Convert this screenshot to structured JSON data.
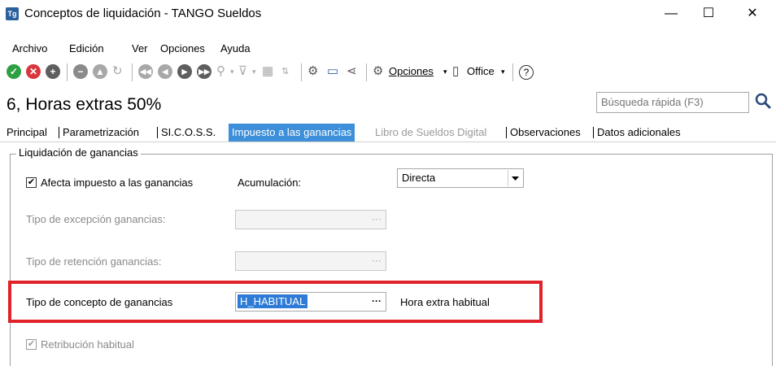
{
  "window": {
    "app_icon_text": "Tg",
    "title": "Conceptos de liquidación - TANGO Sueldos",
    "minimize": "—",
    "maximize": "☐",
    "close": "✕"
  },
  "menu": {
    "items": [
      "Archivo",
      "Edición",
      "Ver",
      "Opciones",
      "Ayuda"
    ]
  },
  "toolbar": {
    "opciones_label": "Opciones",
    "office_label": "Office",
    "help": "?"
  },
  "record": {
    "title": "6, Horas extras  50%"
  },
  "search": {
    "placeholder": "Búsqueda rápida (F3)"
  },
  "tabs": [
    {
      "label": "Principal",
      "state": "normal"
    },
    {
      "label": "Parametrización",
      "state": "normal"
    },
    {
      "label": "SI.C.O.S.S.",
      "state": "normal"
    },
    {
      "label": "Impuesto a las ganancias",
      "state": "active"
    },
    {
      "label": "Libro de Sueldos Digital",
      "state": "disabled"
    },
    {
      "label": "Observaciones",
      "state": "normal"
    },
    {
      "label": "Datos adicionales",
      "state": "normal"
    }
  ],
  "group": {
    "title": "Liquidación de ganancias",
    "afecta_checkbox": {
      "label": "Afecta impuesto a las ganancias",
      "checked": true
    },
    "acumulacion": {
      "label": "Acumulación:",
      "value": "Directa"
    },
    "tipo_excepcion": {
      "label": "Tipo de excepción ganancias:",
      "value": ""
    },
    "tipo_retencion": {
      "label": "Tipo de retención ganancias:",
      "value": ""
    },
    "tipo_concepto": {
      "label": "Tipo de concepto de ganancias",
      "value": "H_HABITUAL",
      "description": "Hora extra habitual"
    },
    "retribucion_checkbox": {
      "label": "Retribución habitual",
      "checked": true
    }
  },
  "colors": {
    "active_tab_bg": "#3c8fd8",
    "highlight_border": "#e0232b",
    "selection_bg": "#2d7bd6"
  }
}
